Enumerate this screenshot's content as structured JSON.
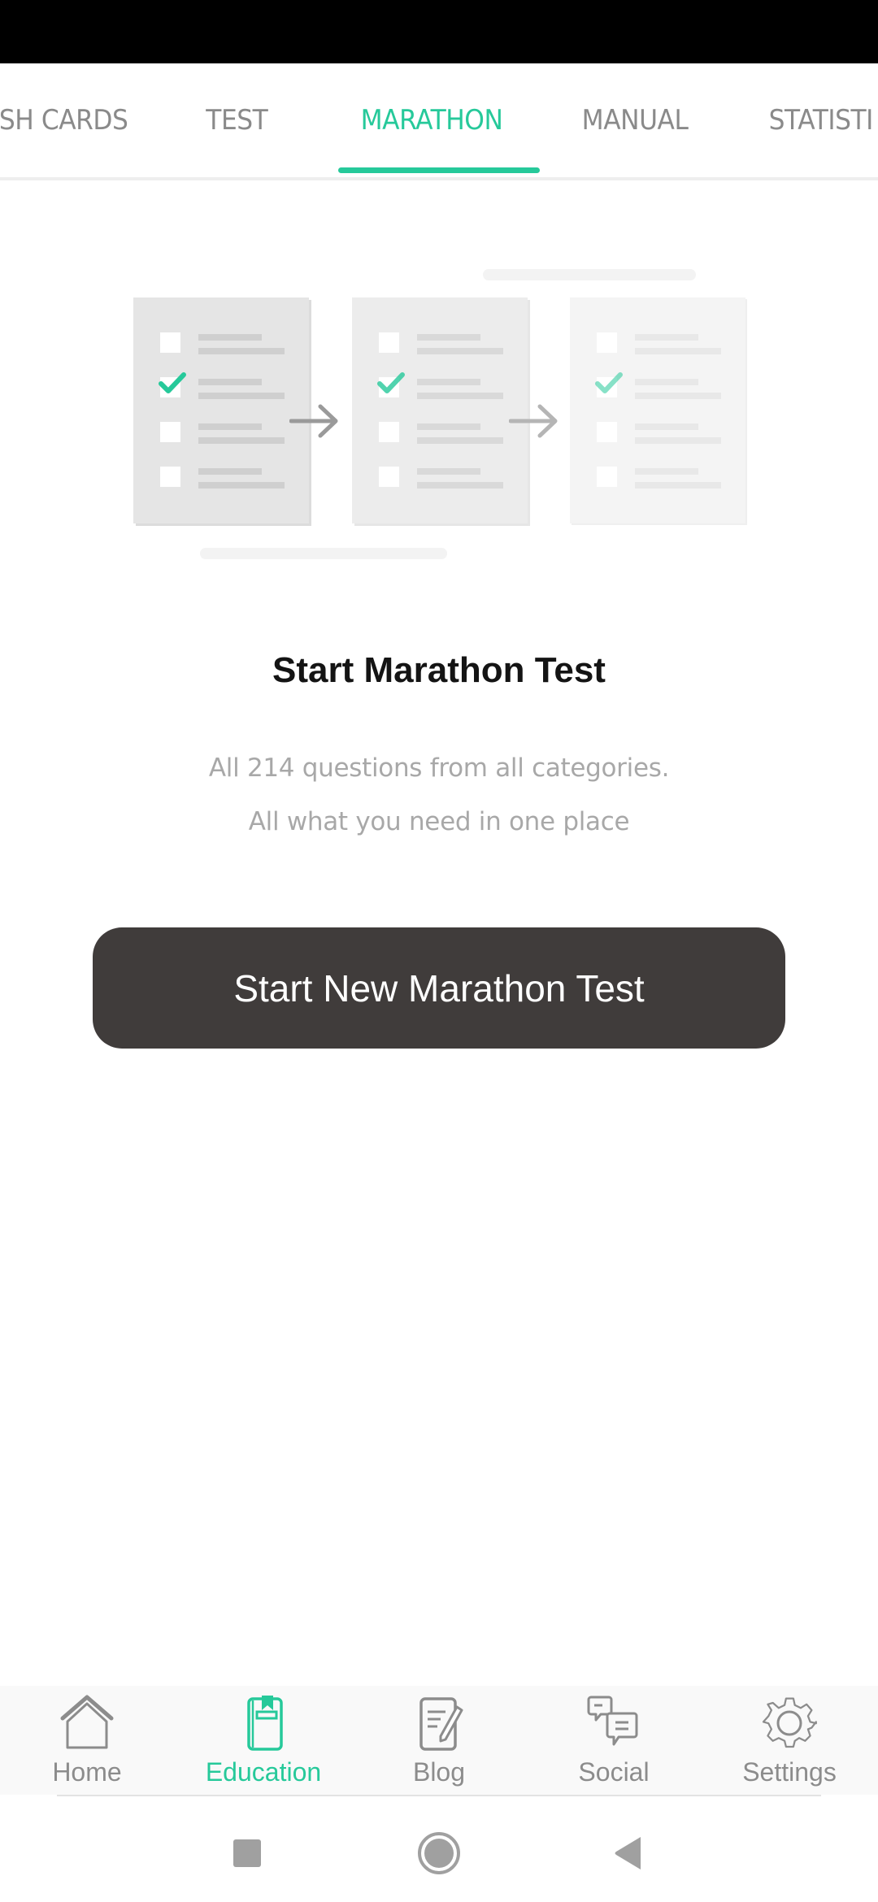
{
  "tabs": [
    {
      "label": "FLASH CARDS",
      "visible_label": "SH CARDS",
      "active": false
    },
    {
      "label": "TEST",
      "active": false
    },
    {
      "label": "MARATHON",
      "active": true
    },
    {
      "label": "MANUAL",
      "active": false
    },
    {
      "label": "STATISTICS",
      "visible_label": "STATISTI",
      "active": false
    }
  ],
  "illustration": {
    "description": "three question sheets with arrows",
    "icon": "checklist-progress-illustration"
  },
  "main": {
    "title": "Start Marathon Test",
    "subtitle_line1": "All 214 questions from all categories.",
    "subtitle_line2": "All what you need in one place",
    "start_button_label": "Start New Marathon Test"
  },
  "bottom_nav": {
    "items": [
      {
        "label": "Home",
        "icon": "home-icon",
        "active": false
      },
      {
        "label": "Education",
        "icon": "book-icon",
        "active": true
      },
      {
        "label": "Blog",
        "icon": "blog-edit-icon",
        "active": false
      },
      {
        "label": "Social",
        "icon": "chat-bubbles-icon",
        "active": false
      },
      {
        "label": "Settings",
        "icon": "gear-icon",
        "active": false
      }
    ]
  },
  "system_nav": {
    "recents": "recents-icon",
    "home": "home-circle-icon",
    "back": "back-icon"
  },
  "colors": {
    "accent": "#26c99a",
    "button_bg": "#403c3b",
    "inactive": "#8c8c8c"
  }
}
